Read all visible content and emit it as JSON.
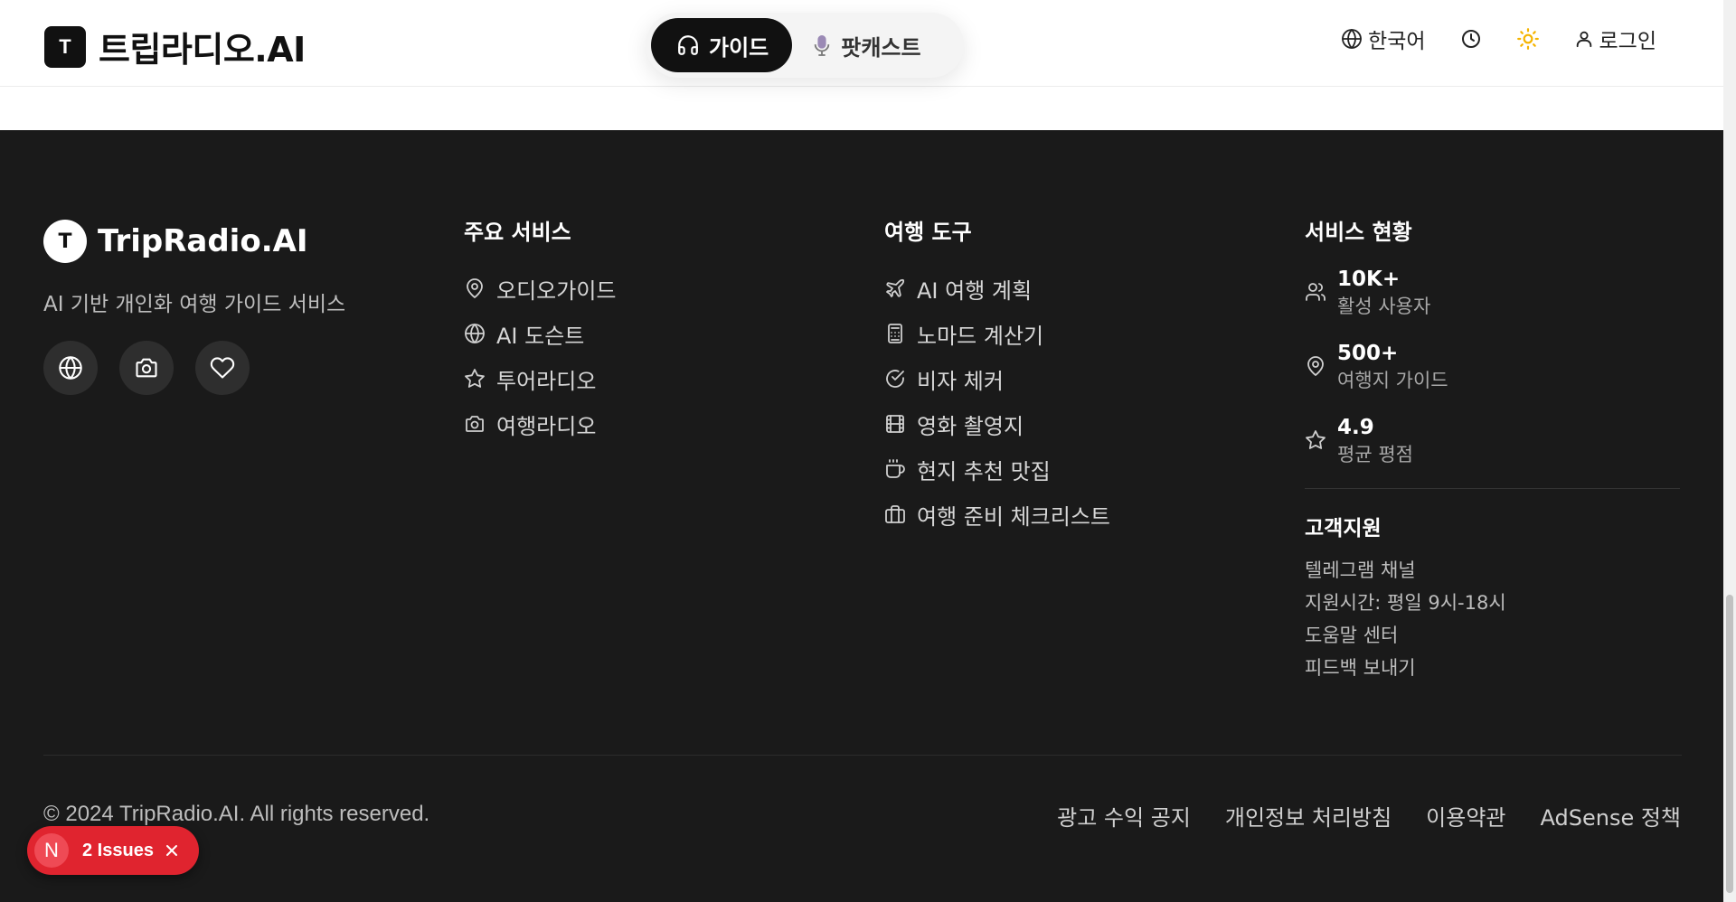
{
  "header": {
    "logo_mark": "T",
    "logo_text": "트립라디오.AI",
    "tabs": [
      {
        "label": "가이드",
        "active": true,
        "icon": "headphones-icon"
      },
      {
        "label": "팟캐스트",
        "active": false,
        "icon": "microphone-icon"
      }
    ],
    "language_label": "한국어",
    "login_label": "로그인",
    "accent_sun": "#f5b400"
  },
  "footer": {
    "brand_mark": "T",
    "brand_name": "TripRadio.AI",
    "tagline": "AI 기반 개인화 여행 가이드 서비스",
    "socials": [
      "globe-icon",
      "camera-icon",
      "heart-icon"
    ],
    "services": {
      "title": "주요 서비스",
      "items": [
        {
          "label": "오디오가이드",
          "icon": "map-pin-icon"
        },
        {
          "label": "AI 도슨트",
          "icon": "globe-icon"
        },
        {
          "label": "투어라디오",
          "icon": "star-icon"
        },
        {
          "label": "여행라디오",
          "icon": "camera-icon"
        }
      ]
    },
    "tools": {
      "title": "여행 도구",
      "items": [
        {
          "label": "AI 여행 계획",
          "icon": "plane-icon"
        },
        {
          "label": "노마드 계산기",
          "icon": "calculator-icon"
        },
        {
          "label": "비자 체커",
          "icon": "check-circle-icon"
        },
        {
          "label": "영화 촬영지",
          "icon": "film-icon"
        },
        {
          "label": "현지 추천 맛집",
          "icon": "coffee-icon"
        },
        {
          "label": "여행 준비 체크리스트",
          "icon": "briefcase-icon"
        }
      ]
    },
    "status": {
      "title": "서비스 현황",
      "stats": [
        {
          "value": "10K+",
          "label": "활성 사용자",
          "icon": "users-icon"
        },
        {
          "value": "500+",
          "label": "여행지 가이드",
          "icon": "map-pin-icon"
        },
        {
          "value": "4.9",
          "label": "평균 평점",
          "icon": "star-icon"
        }
      ]
    },
    "support": {
      "title": "고객지원",
      "items": [
        "텔레그램 채널",
        "지원시간: 평일 9시-18시",
        "도움말 센터",
        "피드백 보내기"
      ]
    },
    "copyright": "© 2024 TripRadio.AI. All rights reserved.",
    "legal_links": [
      "광고 수익 공지",
      "개인정보 처리방침",
      "이용약관",
      "AdSense 정책"
    ]
  },
  "issues_badge": {
    "letter": "N",
    "label": "2 Issues",
    "color": "#e0242f"
  }
}
